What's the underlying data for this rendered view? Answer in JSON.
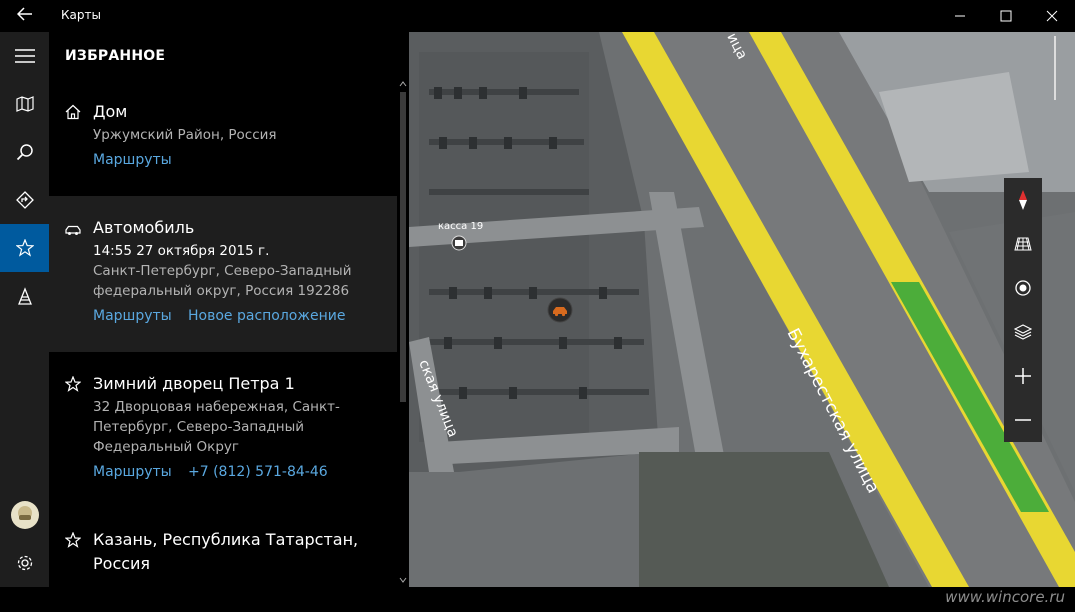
{
  "window": {
    "title": "Карты"
  },
  "panel": {
    "header": "ИЗБРАННОЕ",
    "favorites": [
      {
        "icon": "home-icon",
        "name": "Дом",
        "lines": [
          "Уржумский Район, Россия"
        ],
        "links": [
          "Маршруты"
        ]
      },
      {
        "icon": "car-icon",
        "name": "Автомобиль",
        "datetime": "14:55 27 октября 2015 г.",
        "lines": [
          "Санкт-Петербург, Северо-Западный",
          "федеральный округ, Россия 192286"
        ],
        "links": [
          "Маршруты",
          "Новое расположение"
        ]
      },
      {
        "icon": "star-icon",
        "name": "Зимний дворец Петра 1",
        "lines": [
          "32 Дворцовая набережная, Санкт-",
          "Петербург, Северо-Западный",
          "Федеральный Округ"
        ],
        "links": [
          "Маршруты",
          "+7 (812) 571-84-46"
        ]
      },
      {
        "icon": "star-icon",
        "name_lines": [
          "Казань, Республика Татарстан,",
          "Россия"
        ]
      }
    ]
  },
  "map": {
    "labels": {
      "street_main": "Бухарестская улица",
      "street_side": "ская улица",
      "street_top": "ица",
      "poi": "касса 19"
    },
    "watermark": "www.wincore.ru"
  },
  "colors": {
    "accent": "#005a9e",
    "link": "#5aa8e0",
    "road_yellow": "#e8d732",
    "traffic_green": "#4cad3a",
    "car_marker": "#d76a1e"
  }
}
